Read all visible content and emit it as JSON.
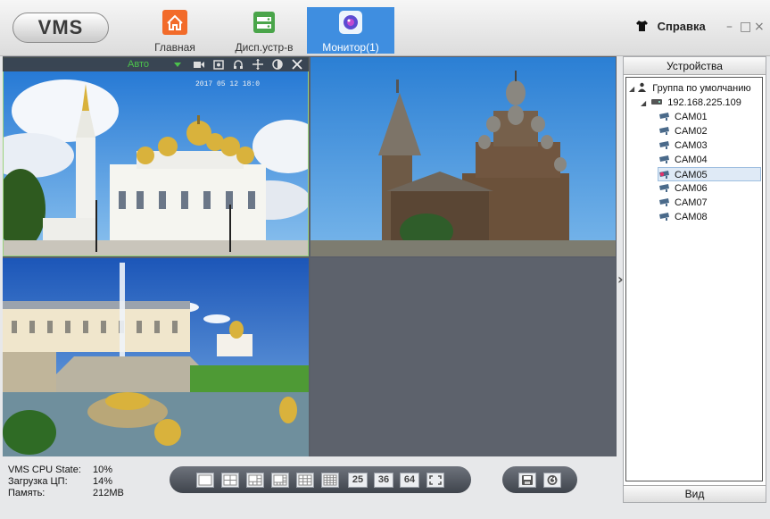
{
  "app": {
    "logo": "VMS",
    "tabs": [
      {
        "label": "Главная",
        "icon": "home-icon"
      },
      {
        "label": "Дисп.устр-в",
        "icon": "device-manager-icon"
      },
      {
        "label": "Монитор(1)",
        "icon": "monitor-icon",
        "active": true
      }
    ],
    "help_label": "Справка",
    "window_controls": [
      "–",
      "□",
      "×"
    ]
  },
  "video": {
    "stream_mode": "Авто",
    "timestamp": "2017 05 12 18:0",
    "ptz_icons": [
      "video-record-icon",
      "snapshot-icon",
      "audio-icon",
      "ptz-move-icon",
      "color-adjust-icon",
      "close-icon"
    ]
  },
  "device_panel": {
    "header": "Устройства",
    "group": "Группа по умолчанию",
    "device_ip": "192.168.225.109",
    "cameras": [
      "CAM01",
      "CAM02",
      "CAM03",
      "CAM04",
      "CAM05",
      "CAM06",
      "CAM07",
      "CAM08"
    ],
    "selected_camera": "CAM05",
    "footer": "Вид"
  },
  "status": {
    "rows": [
      {
        "label": "VMS CPU State:",
        "value": "10%"
      },
      {
        "label": "Загрузка ЦП:",
        "value": "14%"
      },
      {
        "label": "Память:",
        "value": "212MB"
      }
    ]
  },
  "layout_toolbar": {
    "layouts": [
      "layout-1-icon",
      "layout-4-icon",
      "layout-6-icon",
      "layout-8-icon",
      "layout-9-icon",
      "layout-16-icon"
    ],
    "numbers": [
      "25",
      "36",
      "64"
    ],
    "fullscreen": "fullscreen-icon"
  },
  "record_toolbar": [
    "save-icon",
    "refresh-icon"
  ],
  "colors": {
    "accent": "#3f8ee0",
    "status_green": "#4cc24c",
    "panel_bg": "#5d626c"
  }
}
